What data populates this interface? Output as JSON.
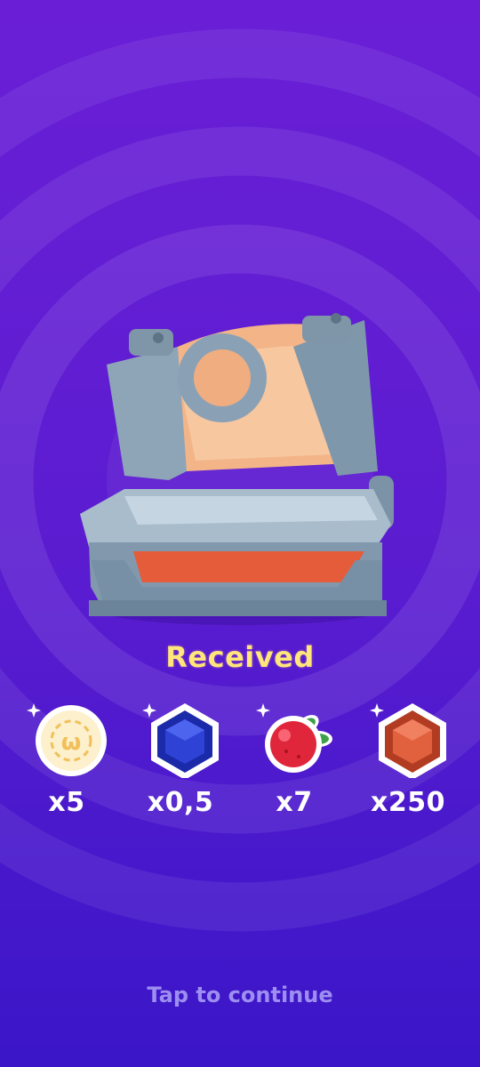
{
  "screen": {
    "title": "Received",
    "continue_label": "Tap to continue"
  },
  "rewards": [
    {
      "icon": "coin-icon",
      "quantity": "x5"
    },
    {
      "icon": "blue-gem-icon",
      "quantity": "x0,5"
    },
    {
      "icon": "cranberry-icon",
      "quantity": "x7"
    },
    {
      "icon": "orange-gem-icon",
      "quantity": "x250"
    }
  ],
  "colors": {
    "background_top": "#6a1fd6",
    "background_bottom": "#3a16c8",
    "title": "#ffe67a",
    "continue_text": "#9d8ef0",
    "chest_metal": "#8fa6b8",
    "chest_wood": "#f5b98c"
  }
}
